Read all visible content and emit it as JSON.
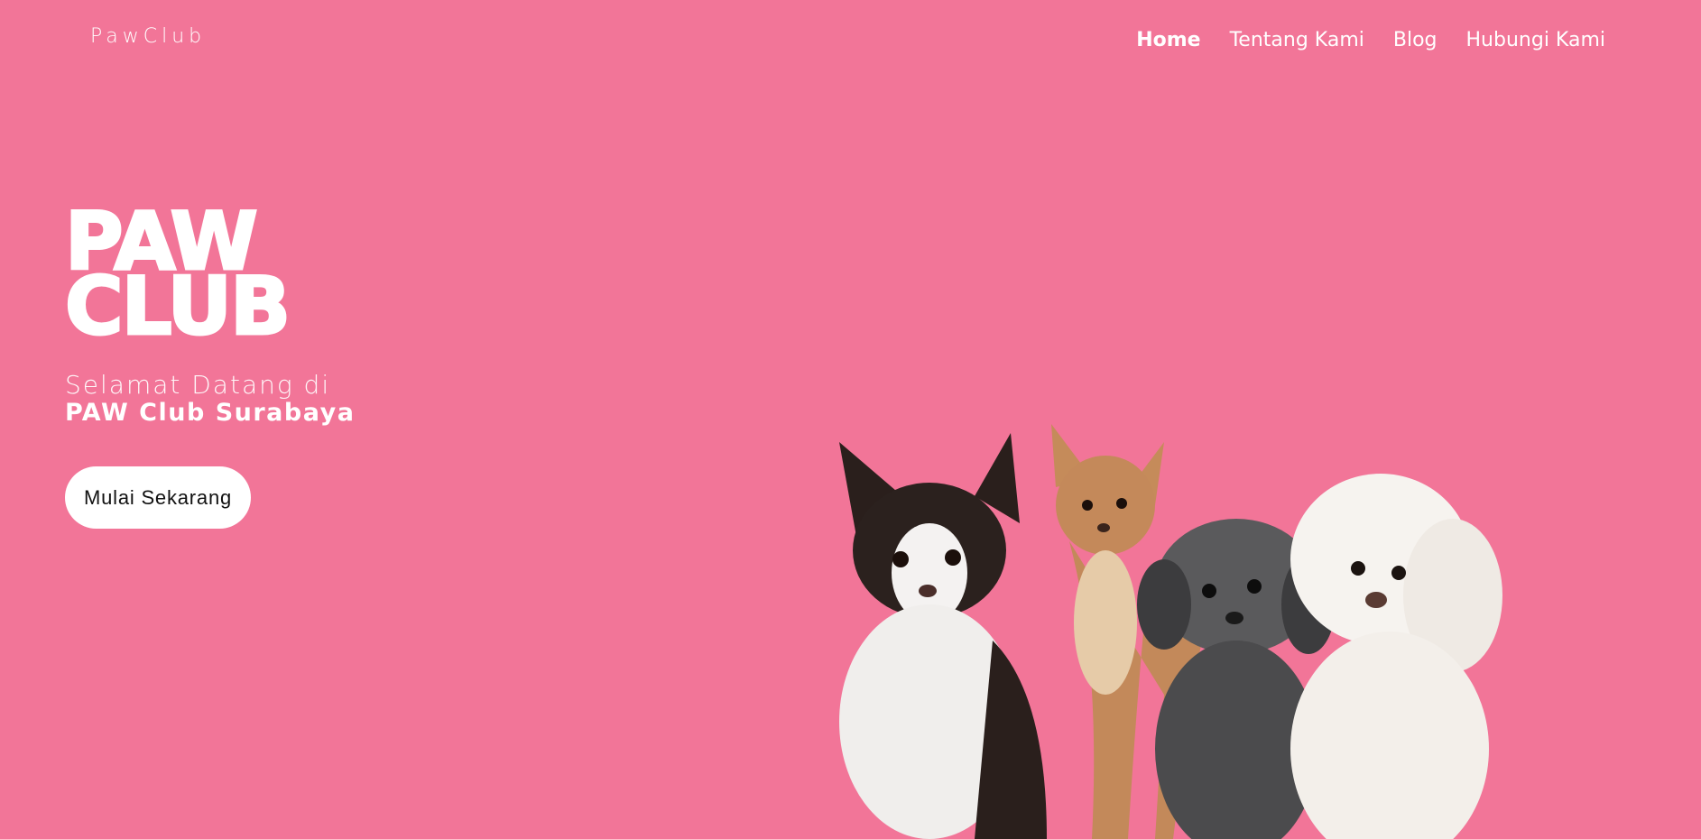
{
  "header": {
    "brand": "PawClub",
    "nav": [
      {
        "label": "Home",
        "active": true
      },
      {
        "label": "Tentang Kami",
        "active": false
      },
      {
        "label": "Blog",
        "active": false
      },
      {
        "label": "Hubungi Kami",
        "active": false
      }
    ]
  },
  "hero": {
    "logo_line1": "PAW",
    "logo_line2": "CLUB",
    "welcome": "Selamat Datang di",
    "welcome_strong": "PAW Club Surabaya",
    "cta_label": "Mulai Sekarang"
  },
  "colors": {
    "background": "#f27598",
    "text": "#ffffff",
    "button_bg": "#ffffff",
    "button_text": "#111111"
  }
}
